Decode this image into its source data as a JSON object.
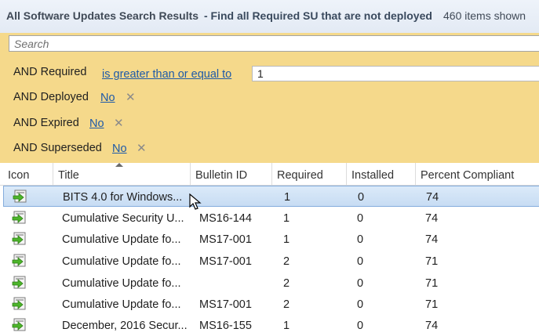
{
  "window": {
    "title": "All Software Updates Search Results",
    "query": " - Find all Required SU that are not deployed",
    "count": "460 items shown"
  },
  "search": {
    "placeholder": "Search"
  },
  "criteria": [
    {
      "label": "AND Required",
      "operator": "is greater than or equal to",
      "value": "1"
    },
    {
      "label": "AND Deployed",
      "value": "No"
    },
    {
      "label": "AND Expired",
      "value": "No"
    },
    {
      "label": "AND Superseded",
      "value": "No"
    }
  ],
  "columns": [
    "Icon",
    "Title",
    "Bulletin ID",
    "Required",
    "Installed",
    "Percent Compliant"
  ],
  "rows": [
    {
      "title": "BITS 4.0 for Windows...",
      "bulletin": "",
      "required": "1",
      "installed": "0",
      "compliant": "74"
    },
    {
      "title": "Cumulative Security U...",
      "bulletin": "MS16-144",
      "required": "1",
      "installed": "0",
      "compliant": "74"
    },
    {
      "title": "Cumulative Update fo...",
      "bulletin": "MS17-001",
      "required": "1",
      "installed": "0",
      "compliant": "74"
    },
    {
      "title": "Cumulative Update fo...",
      "bulletin": "MS17-001",
      "required": "2",
      "installed": "0",
      "compliant": "71"
    },
    {
      "title": "Cumulative Update fo...",
      "bulletin": "",
      "required": "2",
      "installed": "0",
      "compliant": "71"
    },
    {
      "title": "Cumulative Update fo...",
      "bulletin": "MS17-001",
      "required": "2",
      "installed": "0",
      "compliant": "71"
    },
    {
      "title": "December, 2016 Secur...",
      "bulletin": "MS16-155",
      "required": "1",
      "installed": "0",
      "compliant": "74"
    }
  ],
  "colors": {
    "criteria_bg": "#f5d98b",
    "link": "#1e5aa8",
    "selected_row": "#c7dcf3"
  }
}
